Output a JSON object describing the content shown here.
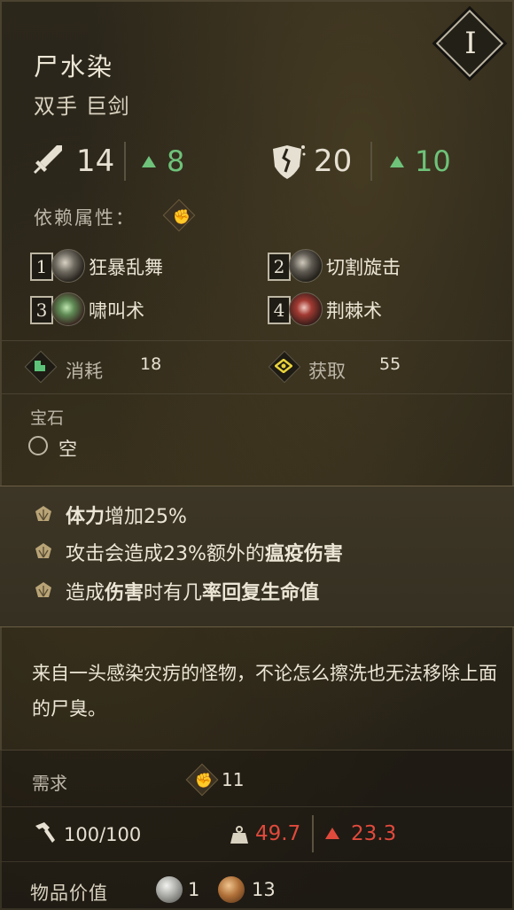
{
  "item": {
    "name": "尸水染",
    "type": "双手 巨剑",
    "level": "I"
  },
  "stats": {
    "attack": {
      "icon": "sword-icon",
      "value": "14",
      "bonus": "8"
    },
    "stagger": {
      "icon": "shattered-shield-icon",
      "value": "20",
      "bonus": "10"
    }
  },
  "dependency": {
    "label": "依赖属性：",
    "icon": "strength-arm-icon"
  },
  "skills": [
    {
      "num": "1",
      "label": "狂暴乱舞"
    },
    {
      "num": "2",
      "label": "切割旋击"
    },
    {
      "num": "3",
      "label": "啸叫术"
    },
    {
      "num": "4",
      "label": "荆棘术"
    }
  ],
  "resources": {
    "consume": {
      "label": "消耗",
      "value": "18"
    },
    "gain": {
      "label": "获取",
      "value": "55"
    }
  },
  "gem": {
    "label": "宝石",
    "value": "空"
  },
  "perks": [
    {
      "b1": "体力",
      "t1": "增加25%"
    },
    {
      "t1": "攻击会造成23%额外的",
      "b1": "瘟疫伤害"
    },
    {
      "t1": "造成",
      "b1": "伤害",
      "t2": "时有几",
      "b2": "率",
      "b3": "回复生命值"
    }
  ],
  "description": "来自一头感染灾疠的怪物，不论怎么擦洗也无法移除上面的尸臭。",
  "requirements": {
    "label": "需求",
    "value": "11"
  },
  "durability": "100/100",
  "weight": "49.7",
  "requirement_penalty": "23.3",
  "item_value": {
    "label": "物品价值",
    "silver": "1",
    "copper": "13"
  },
  "colors": {
    "green": "#6fc27a",
    "red": "#e04a3c"
  }
}
